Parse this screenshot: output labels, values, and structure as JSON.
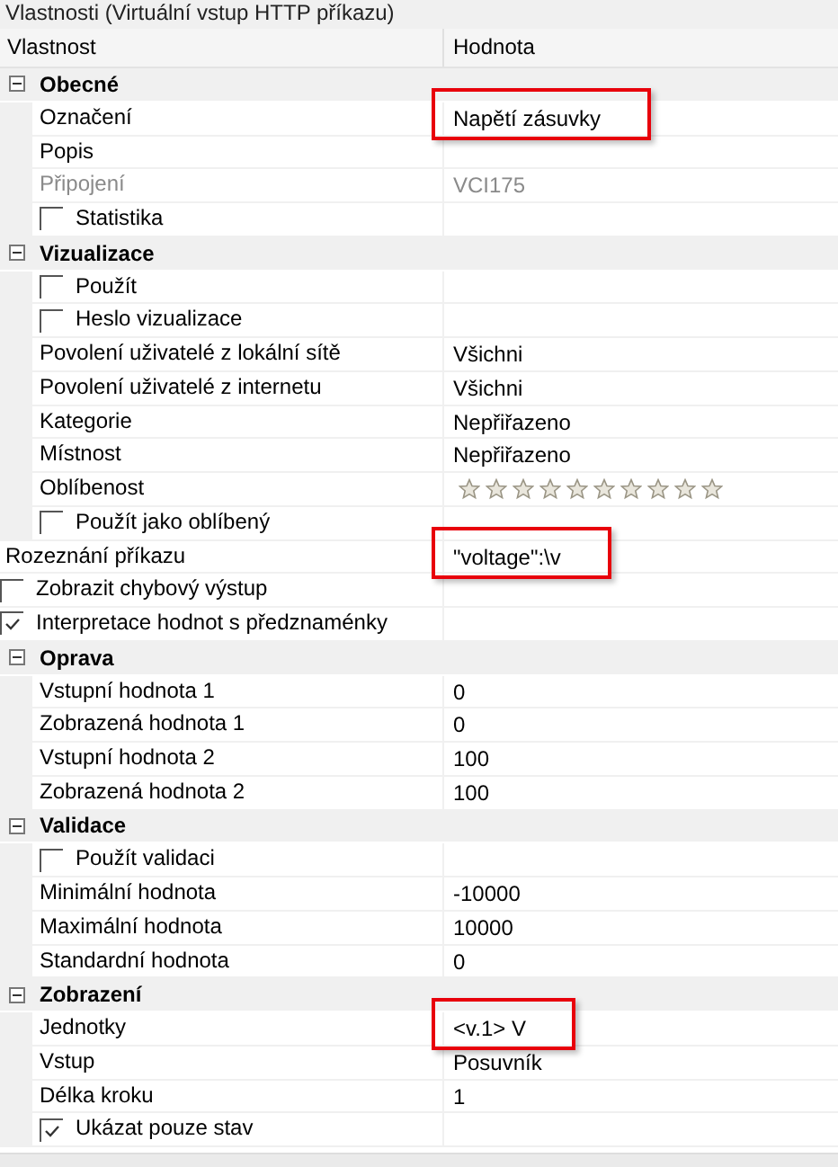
{
  "panel": {
    "title": "Vlastnosti (Virtuální vstup HTTP příkazu)"
  },
  "columns": [
    "Vlastnost",
    "Hodnota"
  ],
  "rows": [
    {
      "kind": "section",
      "label": "Obecné",
      "expanded": true,
      "children": [
        {
          "kind": "property",
          "label": "Označení",
          "value": "Napětí zásuvky",
          "disabled": false,
          "highlighted": true
        },
        {
          "kind": "property",
          "label": "Popis",
          "disabled": false,
          "highlighted": false
        },
        {
          "kind": "property",
          "label": "Připojení",
          "value": "VCI175",
          "disabled": true,
          "highlighted": false
        },
        {
          "kind": "checkbox",
          "label": "Statistika",
          "checked": false
        }
      ]
    },
    {
      "kind": "section",
      "label": "Vizualizace",
      "expanded": true,
      "children": [
        {
          "kind": "checkbox",
          "label": "Použít",
          "checked": false
        },
        {
          "kind": "checkbox",
          "label": "Heslo vizualizace",
          "checked": false
        },
        {
          "kind": "property",
          "label": "Povolení uživatelé z lokální sítě",
          "value": "Všichni",
          "disabled": false,
          "highlighted": false
        },
        {
          "kind": "property",
          "label": "Povolení uživatelé z internetu",
          "value": "Všichni",
          "disabled": false,
          "highlighted": false
        },
        {
          "kind": "property",
          "label": "Kategorie",
          "value": "Nepřiřazeno",
          "disabled": false,
          "highlighted": false
        },
        {
          "kind": "property",
          "label": "Místnost",
          "value": "Nepřiřazeno",
          "disabled": false,
          "highlighted": false
        },
        {
          "kind": "rating",
          "label": "Oblíbenost",
          "stars": 0
        },
        {
          "kind": "checkbox",
          "label": "Použít jako oblíbený",
          "checked": false
        }
      ]
    },
    {
      "kind": "property",
      "label": "Rozeznání příkazu",
      "value": "\"voltage\":\\v",
      "disabled": false,
      "highlighted": true
    },
    {
      "kind": "checkbox",
      "label": "Zobrazit chybový výstup",
      "checked": false
    },
    {
      "kind": "checkbox",
      "label": "Interpretace hodnot s předznaménky",
      "checked": true
    },
    {
      "kind": "section",
      "label": "Oprava",
      "expanded": true,
      "children": [
        {
          "kind": "property",
          "label": "Vstupní hodnota 1",
          "value": "0",
          "disabled": false,
          "highlighted": false
        },
        {
          "kind": "property",
          "label": "Zobrazená hodnota 1",
          "value": "0",
          "disabled": false,
          "highlighted": false
        },
        {
          "kind": "property",
          "label": "Vstupní hodnota 2",
          "value": "100",
          "disabled": false,
          "highlighted": false
        },
        {
          "kind": "property",
          "label": "Zobrazená hodnota 2",
          "value": "100",
          "disabled": false,
          "highlighted": false
        }
      ]
    },
    {
      "kind": "section",
      "label": "Validace",
      "expanded": true,
      "children": [
        {
          "kind": "checkbox",
          "label": "Použít validaci",
          "checked": false
        },
        {
          "kind": "property",
          "label": "Minimální hodnota",
          "value": "-10000",
          "disabled": false,
          "highlighted": false
        },
        {
          "kind": "property",
          "label": "Maximální hodnota",
          "value": "10000",
          "disabled": false,
          "highlighted": false
        },
        {
          "kind": "property",
          "label": "Standardní hodnota",
          "value": "0",
          "disabled": false,
          "highlighted": false
        }
      ]
    },
    {
      "kind": "section",
      "label": "Zobrazení",
      "expanded": true,
      "children": [
        {
          "kind": "property",
          "label": "Jednotky",
          "value": "<v.1> V",
          "disabled": false,
          "highlighted": true
        },
        {
          "kind": "property",
          "label": "Vstup",
          "value": "Posuvník",
          "disabled": false,
          "highlighted": false
        },
        {
          "kind": "property",
          "label": "Délka kroku",
          "value": "1",
          "disabled": false,
          "highlighted": false
        },
        {
          "kind": "checkbox",
          "label": "Ukázat pouze stav",
          "checked": true
        }
      ]
    }
  ]
}
